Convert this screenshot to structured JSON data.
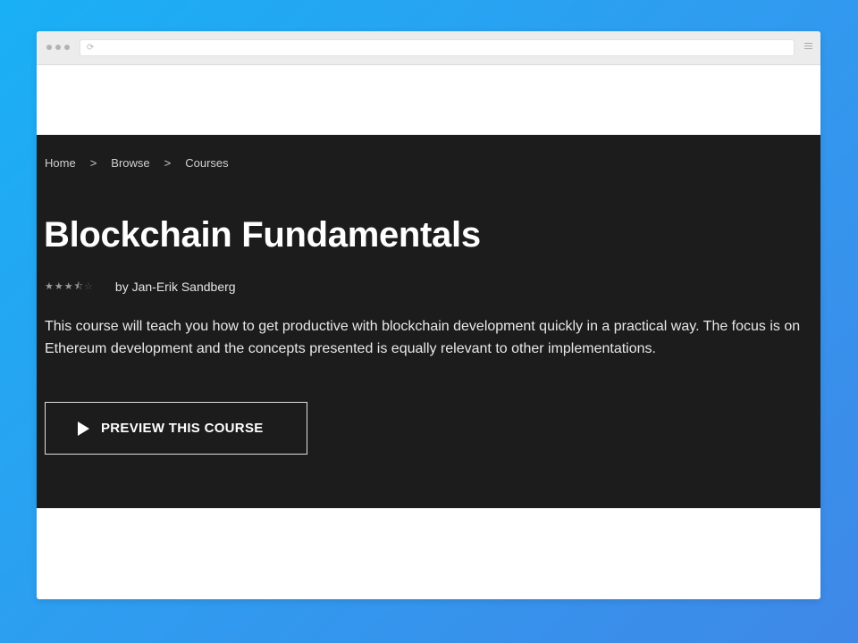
{
  "browser": {
    "reload_glyph": "⟳"
  },
  "breadcrumb": {
    "items": [
      "Home",
      "Browse",
      "Courses"
    ],
    "separator": ">"
  },
  "course": {
    "title": "Blockchain Fundamentals",
    "rating": 3.5,
    "rating_max": 5,
    "author": "by Jan-Erik Sandberg",
    "description": "This course will teach you how to get productive with blockchain development quickly in a practical way. The focus is on Ethereum development and the concepts presented is equally relevant to other implementations.",
    "preview_button_label": "PREVIEW THIS COURSE"
  },
  "icons": {
    "play": "play-icon",
    "star": "star-icon",
    "menu": "hamburger-icon",
    "reload": "reload-icon"
  },
  "colors": {
    "background_gradient_start": "#1ab0f5",
    "background_gradient_end": "#3f88e8",
    "hero_background": "#1c1c1c",
    "text_primary": "#ffffff"
  }
}
